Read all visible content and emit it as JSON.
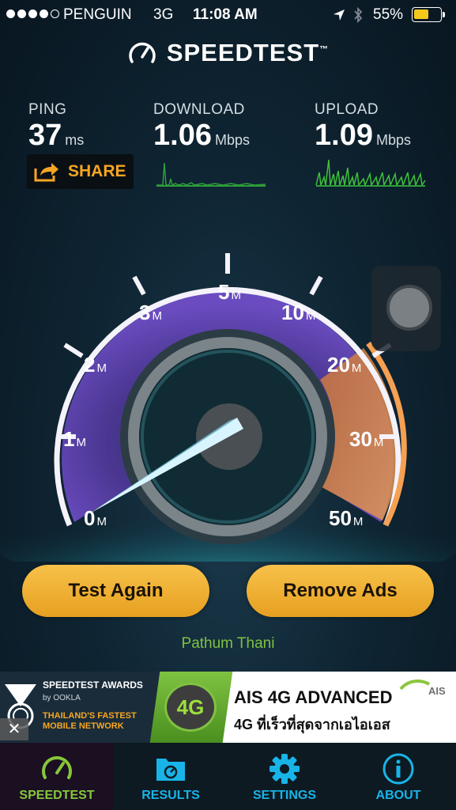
{
  "status_bar": {
    "carrier": "PENGUIN",
    "network": "3G",
    "time": "11:08 AM",
    "battery_percent": "55%",
    "signal_bars_filled": 4,
    "signal_bars_total": 5
  },
  "header": {
    "logo_text": "SPEEDTEST",
    "trademark": "™"
  },
  "stats": {
    "ping": {
      "label": "PING",
      "value": "37",
      "unit": "ms"
    },
    "download": {
      "label": "DOWNLOAD",
      "value": "1.06",
      "unit": "Mbps"
    },
    "upload": {
      "label": "UPLOAD",
      "value": "1.09",
      "unit": "Mbps"
    }
  },
  "share": {
    "label": "SHARE"
  },
  "gauge": {
    "ticks": [
      {
        "value": "0",
        "unit": "M"
      },
      {
        "value": "1",
        "unit": "M"
      },
      {
        "value": "2",
        "unit": "M"
      },
      {
        "value": "3",
        "unit": "M"
      },
      {
        "value": "5",
        "unit": "M"
      },
      {
        "value": "10",
        "unit": "M"
      },
      {
        "value": "20",
        "unit": "M"
      },
      {
        "value": "30",
        "unit": "M"
      },
      {
        "value": "50",
        "unit": "M"
      }
    ],
    "needle_value_mbps": 1.09
  },
  "buttons": {
    "test_again": "Test Again",
    "remove_ads": "Remove Ads"
  },
  "location": "Pathum Thani",
  "ad": {
    "awards": "SPEEDTEST AWARDS",
    "by": "by OOKLA",
    "tagline": "THAILAND'S FASTEST MOBILE NETWORK",
    "badge": "4G",
    "title": "AIS 4G ADVANCED",
    "subtitle": "4G ที่เร็วที่สุดจากเอไอเอส",
    "brand": "AIS",
    "close": "✕"
  },
  "tabs": [
    {
      "label": "SPEEDTEST",
      "icon": "speedometer-icon",
      "active": true
    },
    {
      "label": "RESULTS",
      "icon": "folder-icon",
      "active": false
    },
    {
      "label": "SETTINGS",
      "icon": "gear-icon",
      "active": false
    },
    {
      "label": "ABOUT",
      "icon": "info-icon",
      "active": false
    }
  ],
  "colors": {
    "accent_orange": "#f5a623",
    "accent_green": "#86c73a",
    "tab_blue": "#18b4e8",
    "gauge_purple": "#5a3a9c",
    "button_gold": "#f0b131"
  }
}
